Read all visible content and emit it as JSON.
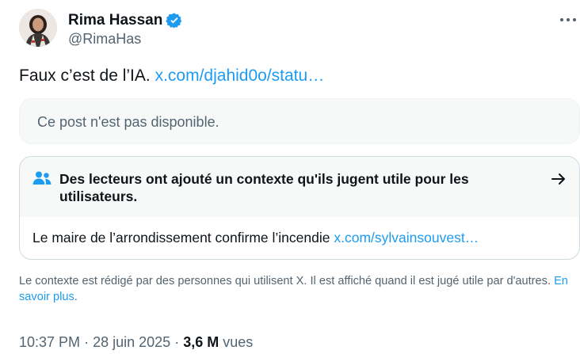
{
  "author": {
    "display_name": "Rima Hassan",
    "handle": "@RimaHas",
    "verified_icon": "verified-badge-icon",
    "more_icon": "more-dots-icon"
  },
  "tweet": {
    "text": "Faux c’est de l’IA.",
    "link": "x.com/djahid0o/statu…"
  },
  "quoted_post": {
    "unavailable_text": "Ce post n'est pas disponible."
  },
  "community_note": {
    "icon": "people-icon",
    "title": "Des lecteurs ont ajouté un contexte qu'ils jugent utile pour les utilisateurs.",
    "arrow_icon": "arrow-right-icon",
    "body_text": "Le maire de l’arrondissement confirme l’incendie",
    "body_link": "x.com/sylvainsouvest…"
  },
  "disclaimer": {
    "text": "Le contexte est rédigé par des personnes qui utilisent X. Il est affiché quand il est jugé utile par d'autres.",
    "link": "En savoir plus",
    "period": "."
  },
  "meta": {
    "time": "10:37 PM",
    "separator": "·",
    "date": "28 juin 2025",
    "views_count": "3,6 M",
    "views_label": "vues"
  },
  "colors": {
    "accent": "#1d9bf0",
    "text": "#0f1419",
    "secondary": "#536471",
    "note_bg": "#f7f9f9",
    "border": "#cfd9de"
  }
}
